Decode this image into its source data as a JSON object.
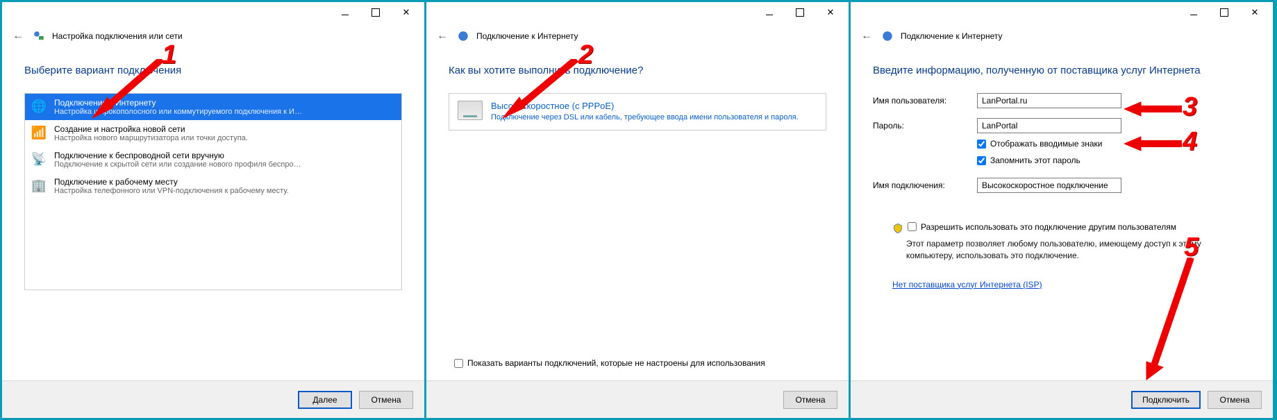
{
  "panel1": {
    "header_title": "Настройка подключения или сети",
    "heading": "Выберите вариант подключения",
    "options": [
      {
        "title": "Подключение к Интернету",
        "desc": "Настройка широкополосного или коммутируемого подключения к Интер..."
      },
      {
        "title": "Создание и настройка новой сети",
        "desc": "Настройка нового маршрутизатора или точки доступа."
      },
      {
        "title": "Подключение к беспроводной сети вручную",
        "desc": "Подключение к скрытой сети или создание нового профиля беспроводн..."
      },
      {
        "title": "Подключение к рабочему месту",
        "desc": "Настройка телефонного или VPN-подключения к рабочему месту."
      }
    ],
    "next_label": "Далее",
    "cancel_label": "Отмена",
    "annotation_number": "1"
  },
  "panel2": {
    "header_title": "Подключение к Интернету",
    "heading": "Как вы хотите выполнить подключение?",
    "card_title": "Высокоскоростное (с PPPoE)",
    "card_desc": "Подключение через DSL или кабель, требующее ввода имени пользователя и пароля.",
    "showall_label": "Показать варианты подключений, которые не настроены для использования",
    "cancel_label": "Отмена",
    "annotation_number": "2"
  },
  "panel3": {
    "header_title": "Подключение к Интернету",
    "heading": "Введите информацию, полученную от поставщика услуг Интернета",
    "username_label": "Имя пользователя:",
    "username_value": "LanPortal.ru",
    "password_label": "Пароль:",
    "password_value": "LanPortal",
    "show_chars_label": "Отображать вводимые знаки",
    "remember_label": "Запомнить этот пароль",
    "connection_name_label": "Имя подключения:",
    "connection_name_value": "Высокоскоростное подключение",
    "allow_others_label": "Разрешить использовать это подключение другим пользователям",
    "allow_others_desc": "Этот параметр позволяет любому пользователю, имеющему доступ к этому компьютеру, использовать это подключение.",
    "isp_link_label": "Нет поставщика услуг Интернета (ISP)",
    "connect_label": "Подключить",
    "cancel_label": "Отмена",
    "annotation_numbers": {
      "user": "3",
      "pass": "4",
      "connect": "5"
    }
  },
  "icons": {
    "back": "←"
  }
}
